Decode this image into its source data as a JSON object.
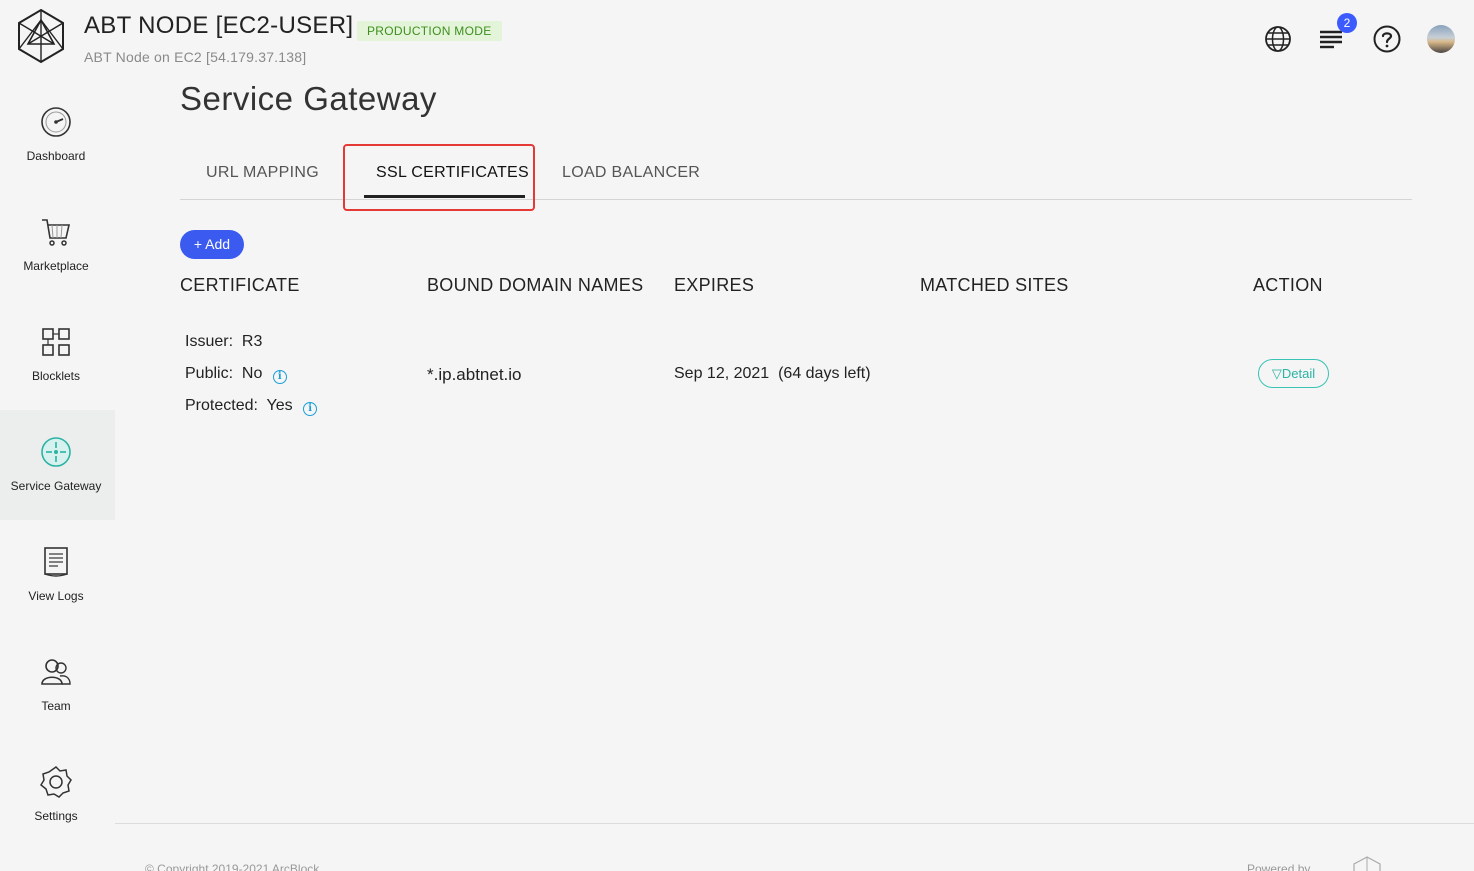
{
  "header": {
    "title": "ABT NODE [EC2-USER]",
    "mode_badge": "PRODUCTION MODE",
    "subtitle": "ABT Node on EC2 [54.179.37.138]",
    "notification_count": "2"
  },
  "sidebar": {
    "items": [
      {
        "label": "Dashboard",
        "icon": "dashboard-gauge-icon",
        "active": false
      },
      {
        "label": "Marketplace",
        "icon": "cart-icon",
        "active": false
      },
      {
        "label": "Blocklets",
        "icon": "blocks-icon",
        "active": false
      },
      {
        "label": "Service Gateway",
        "icon": "gateway-icon",
        "active": true
      },
      {
        "label": "View Logs",
        "icon": "logs-icon",
        "active": false
      },
      {
        "label": "Team",
        "icon": "team-icon",
        "active": false
      },
      {
        "label": "Settings",
        "icon": "gear-icon",
        "active": false
      }
    ]
  },
  "main": {
    "page_title": "Service Gateway",
    "tabs": [
      {
        "label": "URL MAPPING",
        "active": false
      },
      {
        "label": "SSL CERTIFICATES",
        "active": true
      },
      {
        "label": "LOAD BALANCER",
        "active": false
      }
    ],
    "add_button": "+ Add",
    "table": {
      "headers": [
        "CERTIFICATE",
        "BOUND DOMAIN NAMES",
        "EXPIRES",
        "MATCHED SITES",
        "ACTION"
      ],
      "rows": [
        {
          "issuer_label": "Issuer:",
          "issuer": "R3",
          "public_label": "Public:",
          "public": "No",
          "protected_label": "Protected:",
          "protected": "Yes",
          "domain": "*.ip.abtnet.io",
          "expires": "Sep 12, 2021  (64 days left)",
          "matched_sites": "",
          "action": "Detail"
        }
      ]
    }
  },
  "footer": {
    "copyright": "© Copyright 2019-2021 ArcBlock",
    "powered": "Powered by"
  },
  "colors": {
    "accent": "#3b5bf0",
    "badge_bg": "#e3f4d9",
    "badge_fg": "#3e8f1f",
    "teal": "#38c3b4",
    "highlight": "#e53935"
  }
}
